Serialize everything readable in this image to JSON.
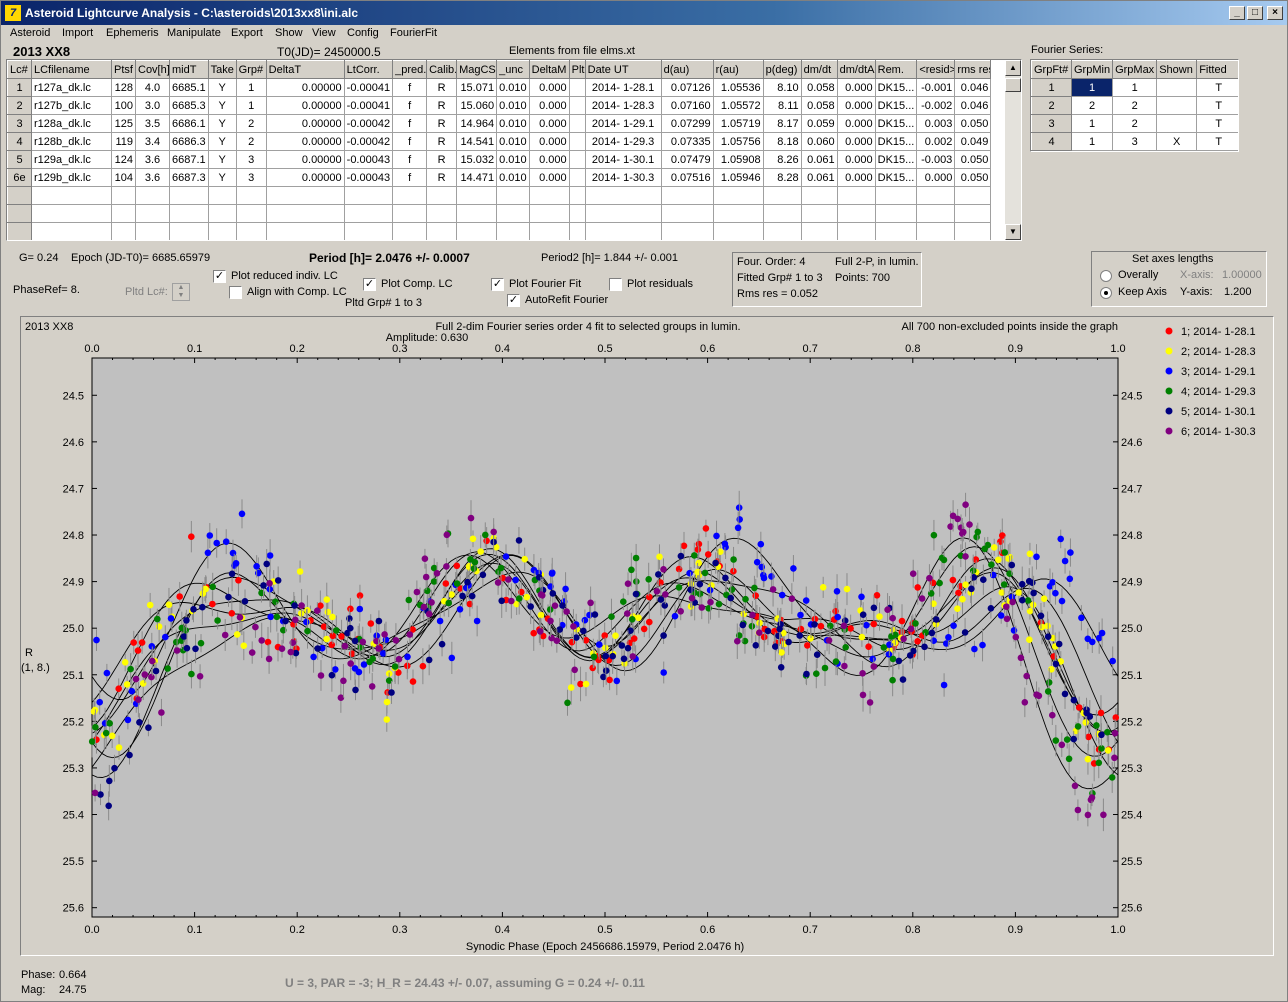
{
  "window": {
    "title": "Asteroid Lightcurve Analysis - C:\\asteroids\\2013xx8\\ini.alc",
    "icon": "app-icon"
  },
  "menu": [
    "Asteroid",
    "Import",
    "Ephemeris",
    "Manipulate",
    "Export",
    "Show",
    "View",
    "Config",
    "FourierFit"
  ],
  "header": {
    "object": "2013 XX8",
    "t0": "T0(JD)= 2450000.5",
    "elements": "Elements from file elms.xt",
    "fourier_title": "Fourier Series:"
  },
  "lc_table": {
    "columns": [
      "Lc#",
      "LCfilename",
      "Ptsf",
      "Cov[h]",
      "midT",
      "Take",
      "Grp#",
      "DeltaT",
      "LtCorr.",
      "_pred.",
      "Calib.",
      "MagCS",
      "_unc",
      "DeltaM",
      "Plt",
      "Date UT",
      "d(au)",
      "r(au)",
      "p(deg)",
      "dm/dt",
      "dm/dtA",
      "Rem.",
      "<resid>",
      "rms res"
    ],
    "rows": [
      [
        "1",
        "r127a_dk.lc",
        "128",
        "4.0",
        "6685.1",
        "Y",
        "1",
        "0.00000",
        "-0.00041",
        "f",
        "R",
        "15.071",
        "0.010",
        "0.000",
        "",
        "2014- 1-28.1",
        "0.07126",
        "1.05536",
        "8.10",
        "0.058",
        "0.000",
        "DK15...",
        "-0.001",
        "0.046"
      ],
      [
        "2",
        "r127b_dk.lc",
        "100",
        "3.0",
        "6685.3",
        "Y",
        "1",
        "0.00000",
        "-0.00041",
        "f",
        "R",
        "15.060",
        "0.010",
        "0.000",
        "",
        "2014- 1-28.3",
        "0.07160",
        "1.05572",
        "8.11",
        "0.058",
        "0.000",
        "DK15...",
        "-0.002",
        "0.046"
      ],
      [
        "3",
        "r128a_dk.lc",
        "125",
        "3.5",
        "6686.1",
        "Y",
        "2",
        "0.00000",
        "-0.00042",
        "f",
        "R",
        "14.964",
        "0.010",
        "0.000",
        "",
        "2014- 1-29.1",
        "0.07299",
        "1.05719",
        "8.17",
        "0.059",
        "0.000",
        "DK15...",
        "0.003",
        "0.050"
      ],
      [
        "4",
        "r128b_dk.lc",
        "119",
        "3.4",
        "6686.3",
        "Y",
        "2",
        "0.00000",
        "-0.00042",
        "f",
        "R",
        "14.541",
        "0.010",
        "0.000",
        "",
        "2014- 1-29.3",
        "0.07335",
        "1.05756",
        "8.18",
        "0.060",
        "0.000",
        "DK15...",
        "0.002",
        "0.049"
      ],
      [
        "5",
        "r129a_dk.lc",
        "124",
        "3.6",
        "6687.1",
        "Y",
        "3",
        "0.00000",
        "-0.00043",
        "f",
        "R",
        "15.032",
        "0.010",
        "0.000",
        "",
        "2014- 1-30.1",
        "0.07479",
        "1.05908",
        "8.26",
        "0.061",
        "0.000",
        "DK15...",
        "-0.003",
        "0.050"
      ],
      [
        "6e",
        "r129b_dk.lc",
        "104",
        "3.6",
        "6687.3",
        "Y",
        "3",
        "0.00000",
        "-0.00043",
        "f",
        "R",
        "14.471",
        "0.010",
        "0.000",
        "",
        "2014- 1-30.3",
        "0.07516",
        "1.05946",
        "8.28",
        "0.061",
        "0.000",
        "DK15...",
        "0.000",
        "0.050"
      ]
    ],
    "empty_rows": 3
  },
  "fourier_table": {
    "columns": [
      "GrpFt#",
      "GrpMin",
      "GrpMax",
      "Shown",
      "Fitted"
    ],
    "rows": [
      [
        "1",
        "1",
        "1",
        "",
        "T"
      ],
      [
        "2",
        "2",
        "2",
        "",
        "T"
      ],
      [
        "3",
        "1",
        "2",
        "",
        "T"
      ],
      [
        "4",
        "1",
        "3",
        "X",
        "T"
      ]
    ]
  },
  "info": {
    "g": "G= 0.24",
    "epoch": "Epoch (JD-T0)= 6685.65979",
    "period": "Period [h]= 2.0476 +/- 0.0007",
    "period2": "Period2 [h]= 1.844 +/- 0.001",
    "phaseref": "PhaseRef= 8.",
    "pltd_lc": "Pltd Lc#:",
    "pltd_grp": "Pltd Grp#  1   to   3",
    "four_order": "Four. Order:  4",
    "full2p": "Full 2-P, in lumin.",
    "fitted_grp": "Fitted Grp# 1 to 3",
    "points": "Points: 700",
    "rms": "Rms res     = 0.052"
  },
  "checks": {
    "reduced": {
      "label": "Plot reduced indiv. LC",
      "checked": true
    },
    "align": {
      "label": "Align with Comp. LC",
      "checked": false
    },
    "comp": {
      "label": "Plot Comp. LC",
      "checked": true
    },
    "fourier": {
      "label": "Plot Fourier Fit",
      "checked": true
    },
    "residuals": {
      "label": "Plot residuals",
      "checked": false
    },
    "autorefit": {
      "label": "AutoRefit Fourier",
      "checked": true
    }
  },
  "axes_box": {
    "title": "Set axes lengths",
    "overally": "Overally",
    "keep": "Keep Axis",
    "xaxis": "X-axis:",
    "xval": "1.00000",
    "yaxis": "Y-axis:",
    "yval": "1.200"
  },
  "plot": {
    "name": "2013 XX8",
    "title1": "Full 2-dim Fourier series order 4 fit to selected groups in lumin.",
    "title2": "Amplitude: 0.630",
    "note": "All 700 non-excluded points inside the graph",
    "xlabel": "Synodic Phase (Epoch 2456686.15979, Period 2.0476 h)",
    "ylabel1": "R",
    "ylabel2": "(1, 8.)",
    "bg": "#c0c0c0"
  },
  "chart_data": {
    "type": "scatter",
    "xlabel": "Synodic Phase (Epoch 2456686.15979, Period 2.0476 h)",
    "ylabel": "R",
    "xlim": [
      0.0,
      1.0
    ],
    "ylim": [
      25.62,
      24.42
    ],
    "x_ticks": [
      "0.0",
      "0.1",
      "0.2",
      "0.3",
      "0.4",
      "0.5",
      "0.6",
      "0.7",
      "0.8",
      "0.9",
      "1.0"
    ],
    "y_ticks": [
      "24.5",
      "24.6",
      "24.7",
      "24.8",
      "24.9",
      "25.0",
      "25.1",
      "25.2",
      "25.3",
      "25.4",
      "25.5",
      "25.6"
    ],
    "series": [
      {
        "name": "1; 2014- 1-28.1",
        "color": "#ff0000"
      },
      {
        "name": "2; 2014- 1-28.3",
        "color": "#ffff00"
      },
      {
        "name": "3; 2014- 1-29.1",
        "color": "#0000ff"
      },
      {
        "name": "4; 2014- 1-29.3",
        "color": "#008000"
      },
      {
        "name": "5; 2014- 1-30.1",
        "color": "#000080"
      },
      {
        "name": "6; 2014- 1-30.3",
        "color": "#800080"
      }
    ]
  },
  "status": {
    "phase_label": "Phase:",
    "phase": "0.664",
    "mag_label": "Mag:",
    "mag": "24.75",
    "hmag": "U = 3, PAR = -3; H_R = 24.43 +/- 0.07, assuming G = 0.24 +/- 0.11"
  }
}
